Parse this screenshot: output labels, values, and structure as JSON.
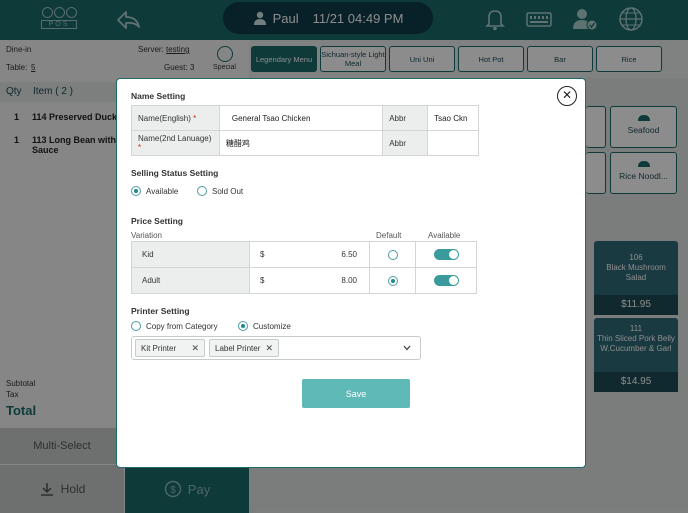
{
  "topbar": {
    "logo_text": "POS",
    "user_name": "Paul",
    "datetime": "11/21 04:49 PM",
    "icons": [
      "back-arrow-icon",
      "user-icon",
      "bell-icon",
      "keyboard-icon",
      "user-check-icon",
      "globe-icon"
    ]
  },
  "order_info": {
    "order_type": "Dine-in",
    "server_label": "Server:",
    "server_name": "testing",
    "table_label": "Table:",
    "table_value": "5",
    "guest_label": "Guest:",
    "guest_value": "3",
    "special_label": "Special"
  },
  "order_list": {
    "qty_header": "Qty",
    "item_header": "Item ( 2 )",
    "items": [
      {
        "qty": "1",
        "name": "114 Preserved Duck"
      },
      {
        "qty": "1",
        "name": "113 Long Bean with Sauce"
      }
    ],
    "subtotal_label": "Subtotal",
    "tax_label": "Tax",
    "total_label": "Total"
  },
  "bottom_buttons": {
    "multi_select": "Multi-Select",
    "hold": "Hold",
    "pay": "Pay"
  },
  "categories": [
    "Legendary Menu",
    "Sichuan-style Light Meal",
    "Uni Uni",
    "Hot Pot",
    "Bar",
    "Rice"
  ],
  "active_category": "Legendary Menu",
  "right_tiles": [
    "Seafood",
    "Rice Noodl..."
  ],
  "menu_items": [
    {
      "number": "106",
      "name": "Black Mushroom Salad",
      "price": "$11.95"
    },
    {
      "number": "111",
      "name": "Thin Sliced Pork Belly W.Cucumber & Garl",
      "price": "$14.95"
    }
  ],
  "modal": {
    "name_setting": {
      "title": "Name Setting",
      "english_label": "Name(English)",
      "english_value": "General Tsao Chicken",
      "abbr_label": "Abbr",
      "abbr_value": "Tsao Ckn",
      "second_label": "Name(2nd Lanuage)",
      "second_value": "糖醋鸡",
      "abbr2_label": "Abbr",
      "abbr2_value": "",
      "required_mark": "*"
    },
    "selling_status": {
      "title": "Selling Status Setting",
      "available": "Available",
      "sold_out": "Sold Out",
      "selected": "Available"
    },
    "price_setting": {
      "title": "Price Setting",
      "variation_header": "Variation",
      "default_header": "Default",
      "available_header": "Available",
      "rows": [
        {
          "name": "Kid",
          "currency": "$",
          "price": "6.50",
          "default": false,
          "available": true
        },
        {
          "name": "Adult",
          "currency": "$",
          "price": "8.00",
          "default": true,
          "available": true
        }
      ]
    },
    "printer_setting": {
      "title": "Printer Setting",
      "copy_from_category": "Copy from Category",
      "customize": "Customize",
      "selected": "Customize",
      "printers": [
        "Kit Printer",
        "Label Printer"
      ]
    },
    "save_label": "Save",
    "close_icon": "close-icon"
  },
  "colors": {
    "brand": "#1d6a6b",
    "accent": "#5eb9b7",
    "required": "#d02020"
  }
}
